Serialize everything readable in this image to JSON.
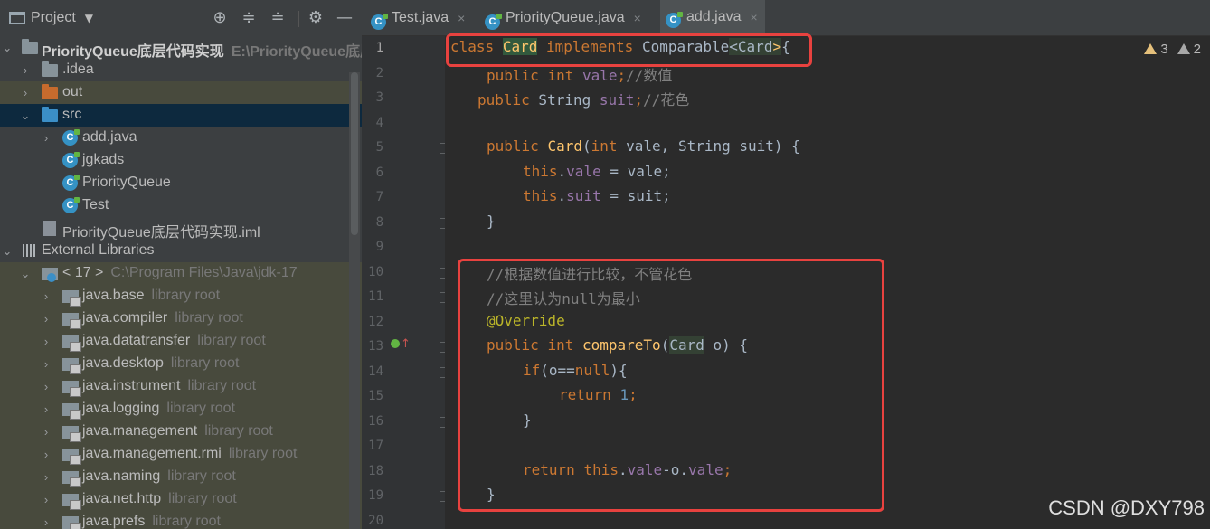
{
  "project_panel": {
    "title": "Project",
    "tree": [
      {
        "label": "PriorityQueue底层代码实现",
        "hint": "E:\\PriorityQueue底层"
      },
      {
        "label": ".idea",
        "hint": ""
      },
      {
        "label": "out",
        "hint": ""
      },
      {
        "label": "src",
        "hint": ""
      },
      {
        "label": "add.java",
        "hint": ""
      },
      {
        "label": "jgkads",
        "hint": ""
      },
      {
        "label": "PriorityQueue",
        "hint": ""
      },
      {
        "label": "Test",
        "hint": ""
      },
      {
        "label": "PriorityQueue底层代码实现.iml",
        "hint": ""
      },
      {
        "label": "External Libraries",
        "hint": ""
      },
      {
        "label": "< 17 >",
        "hint": "C:\\Program Files\\Java\\jdk-17"
      },
      {
        "label": "java.base",
        "hint": "library root"
      },
      {
        "label": "java.compiler",
        "hint": "library root"
      },
      {
        "label": "java.datatransfer",
        "hint": "library root"
      },
      {
        "label": "java.desktop",
        "hint": "library root"
      },
      {
        "label": "java.instrument",
        "hint": "library root"
      },
      {
        "label": "java.logging",
        "hint": "library root"
      },
      {
        "label": "java.management",
        "hint": "library root"
      },
      {
        "label": "java.management.rmi",
        "hint": "library root"
      },
      {
        "label": "java.naming",
        "hint": "library root"
      },
      {
        "label": "java.net.http",
        "hint": "library root"
      },
      {
        "label": "java.prefs",
        "hint": "library root"
      }
    ]
  },
  "tabs": [
    {
      "label": "Test.java",
      "close": "×"
    },
    {
      "label": "PriorityQueue.java",
      "close": "×"
    },
    {
      "label": "add.java",
      "close": "×"
    }
  ],
  "editor": {
    "line_numbers": [
      "1",
      "2",
      "3",
      "4",
      "5",
      "6",
      "7",
      "8",
      "9",
      "10",
      "11",
      "12",
      "13",
      "14",
      "15",
      "16",
      "17",
      "18",
      "19",
      "20"
    ],
    "warnings": {
      "warning_count": "3",
      "weak_warning_count": "2"
    },
    "code": {
      "l1": [
        "class",
        " ",
        "Card",
        " ",
        "implements",
        " Comparable",
        "<Card",
        ">",
        "{"
      ],
      "l2": [
        "public",
        " ",
        "int",
        " ",
        "vale",
        ";",
        "//数值"
      ],
      "l3": [
        "public",
        " String ",
        "suit",
        ";",
        "//花色"
      ],
      "l5": [
        "public",
        " ",
        "Card",
        "(",
        "int",
        " vale, String suit) {"
      ],
      "l6": [
        "this",
        ".",
        "vale",
        " = vale;"
      ],
      "l7": [
        "this",
        ".",
        "suit",
        " = suit;"
      ],
      "l8": [
        "}"
      ],
      "l10": [
        "//根据数值进行比较，不管花色"
      ],
      "l11": [
        "//这里认为null为最小"
      ],
      "l12": [
        "@Override"
      ],
      "l13": [
        "public",
        " ",
        "int",
        " ",
        "compareTo",
        "(",
        "Card",
        " o) {"
      ],
      "l14": [
        "if",
        "(o==",
        "null",
        "){"
      ],
      "l15": [
        "return",
        " ",
        "1",
        ";"
      ],
      "l16": [
        "}"
      ],
      "l18": [
        "return",
        " ",
        "this",
        ".",
        "vale",
        "-o.",
        "vale",
        ";"
      ],
      "l19": [
        "}"
      ]
    }
  },
  "watermark": "CSDN @DXY798"
}
